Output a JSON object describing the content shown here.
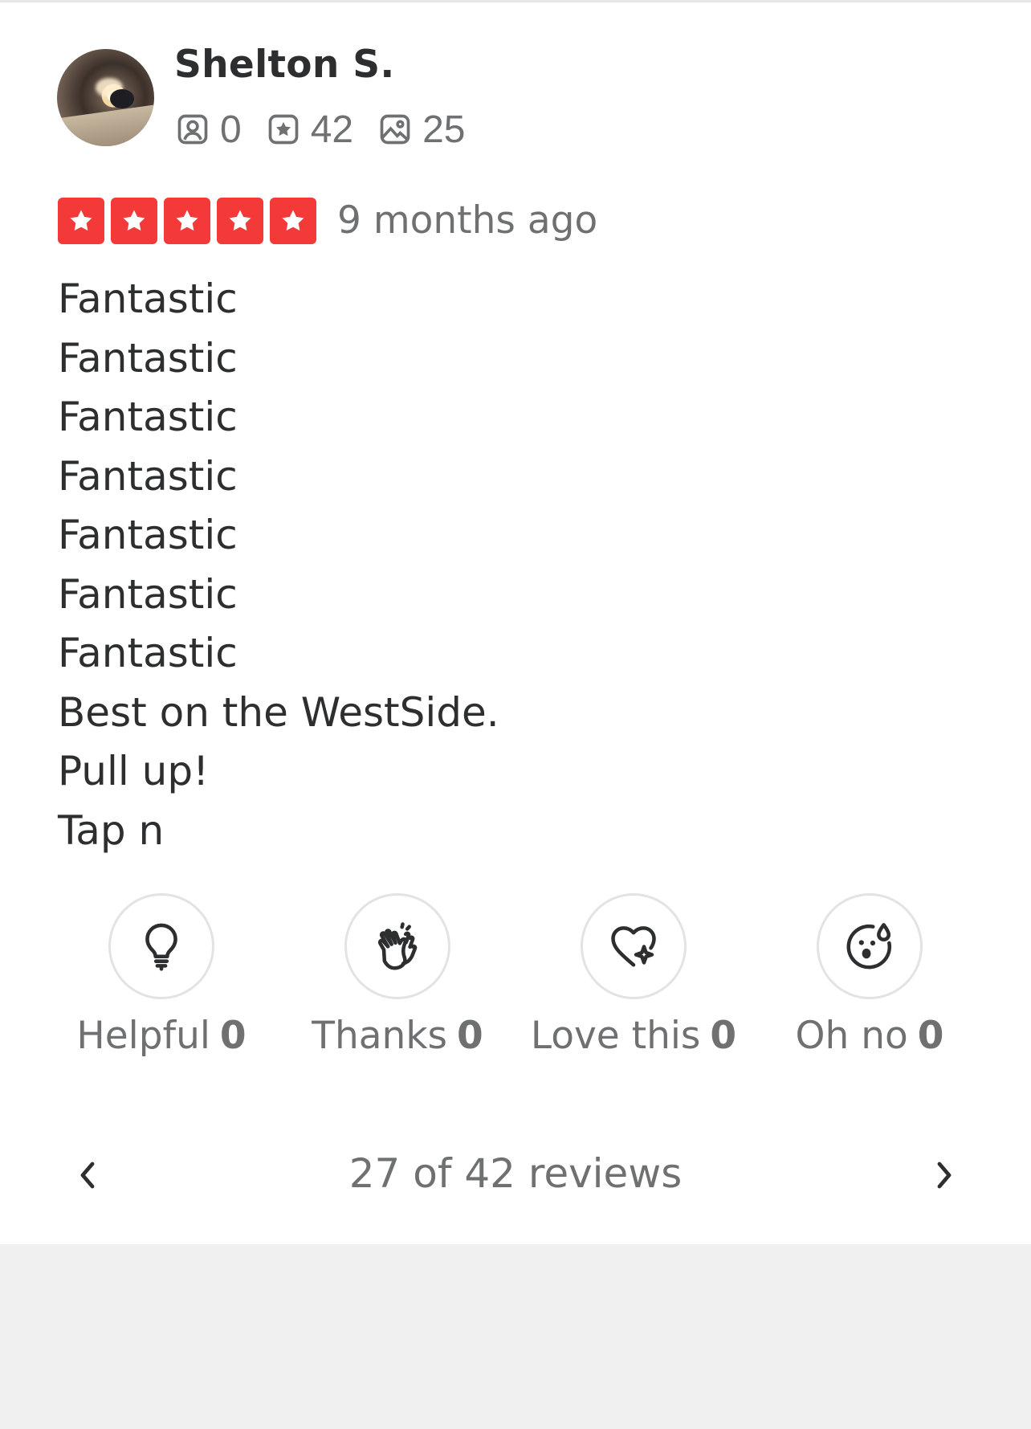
{
  "user": {
    "name": "Shelton S.",
    "friends_count": "0",
    "reviews_count": "42",
    "photos_count": "25",
    "avatar_icon": "avatar-photo"
  },
  "review": {
    "rating": 5,
    "rating_max": 5,
    "date": "9 months ago",
    "lines": [
      "Fantastic",
      "Fantastic",
      "Fantastic",
      "Fantastic",
      "Fantastic",
      "Fantastic",
      "Fantastic",
      "Best on the WestSide.",
      "Pull up!",
      "Tap n"
    ]
  },
  "reactions": [
    {
      "icon": "lightbulb-icon",
      "label": "Helpful",
      "count": "0"
    },
    {
      "icon": "clapping-hands-icon",
      "label": "Thanks",
      "count": "0"
    },
    {
      "icon": "heart-sparkle-icon",
      "label": "Love this",
      "count": "0"
    },
    {
      "icon": "surprised-face-icon",
      "label": "Oh no",
      "count": "0"
    }
  ],
  "pager": {
    "text": "27 of 42 reviews"
  },
  "colors": {
    "star_red": "#f43939",
    "text_dark": "#2d2e2f",
    "text_gray": "#6e7072",
    "page_gray": "#f0f0f0"
  }
}
